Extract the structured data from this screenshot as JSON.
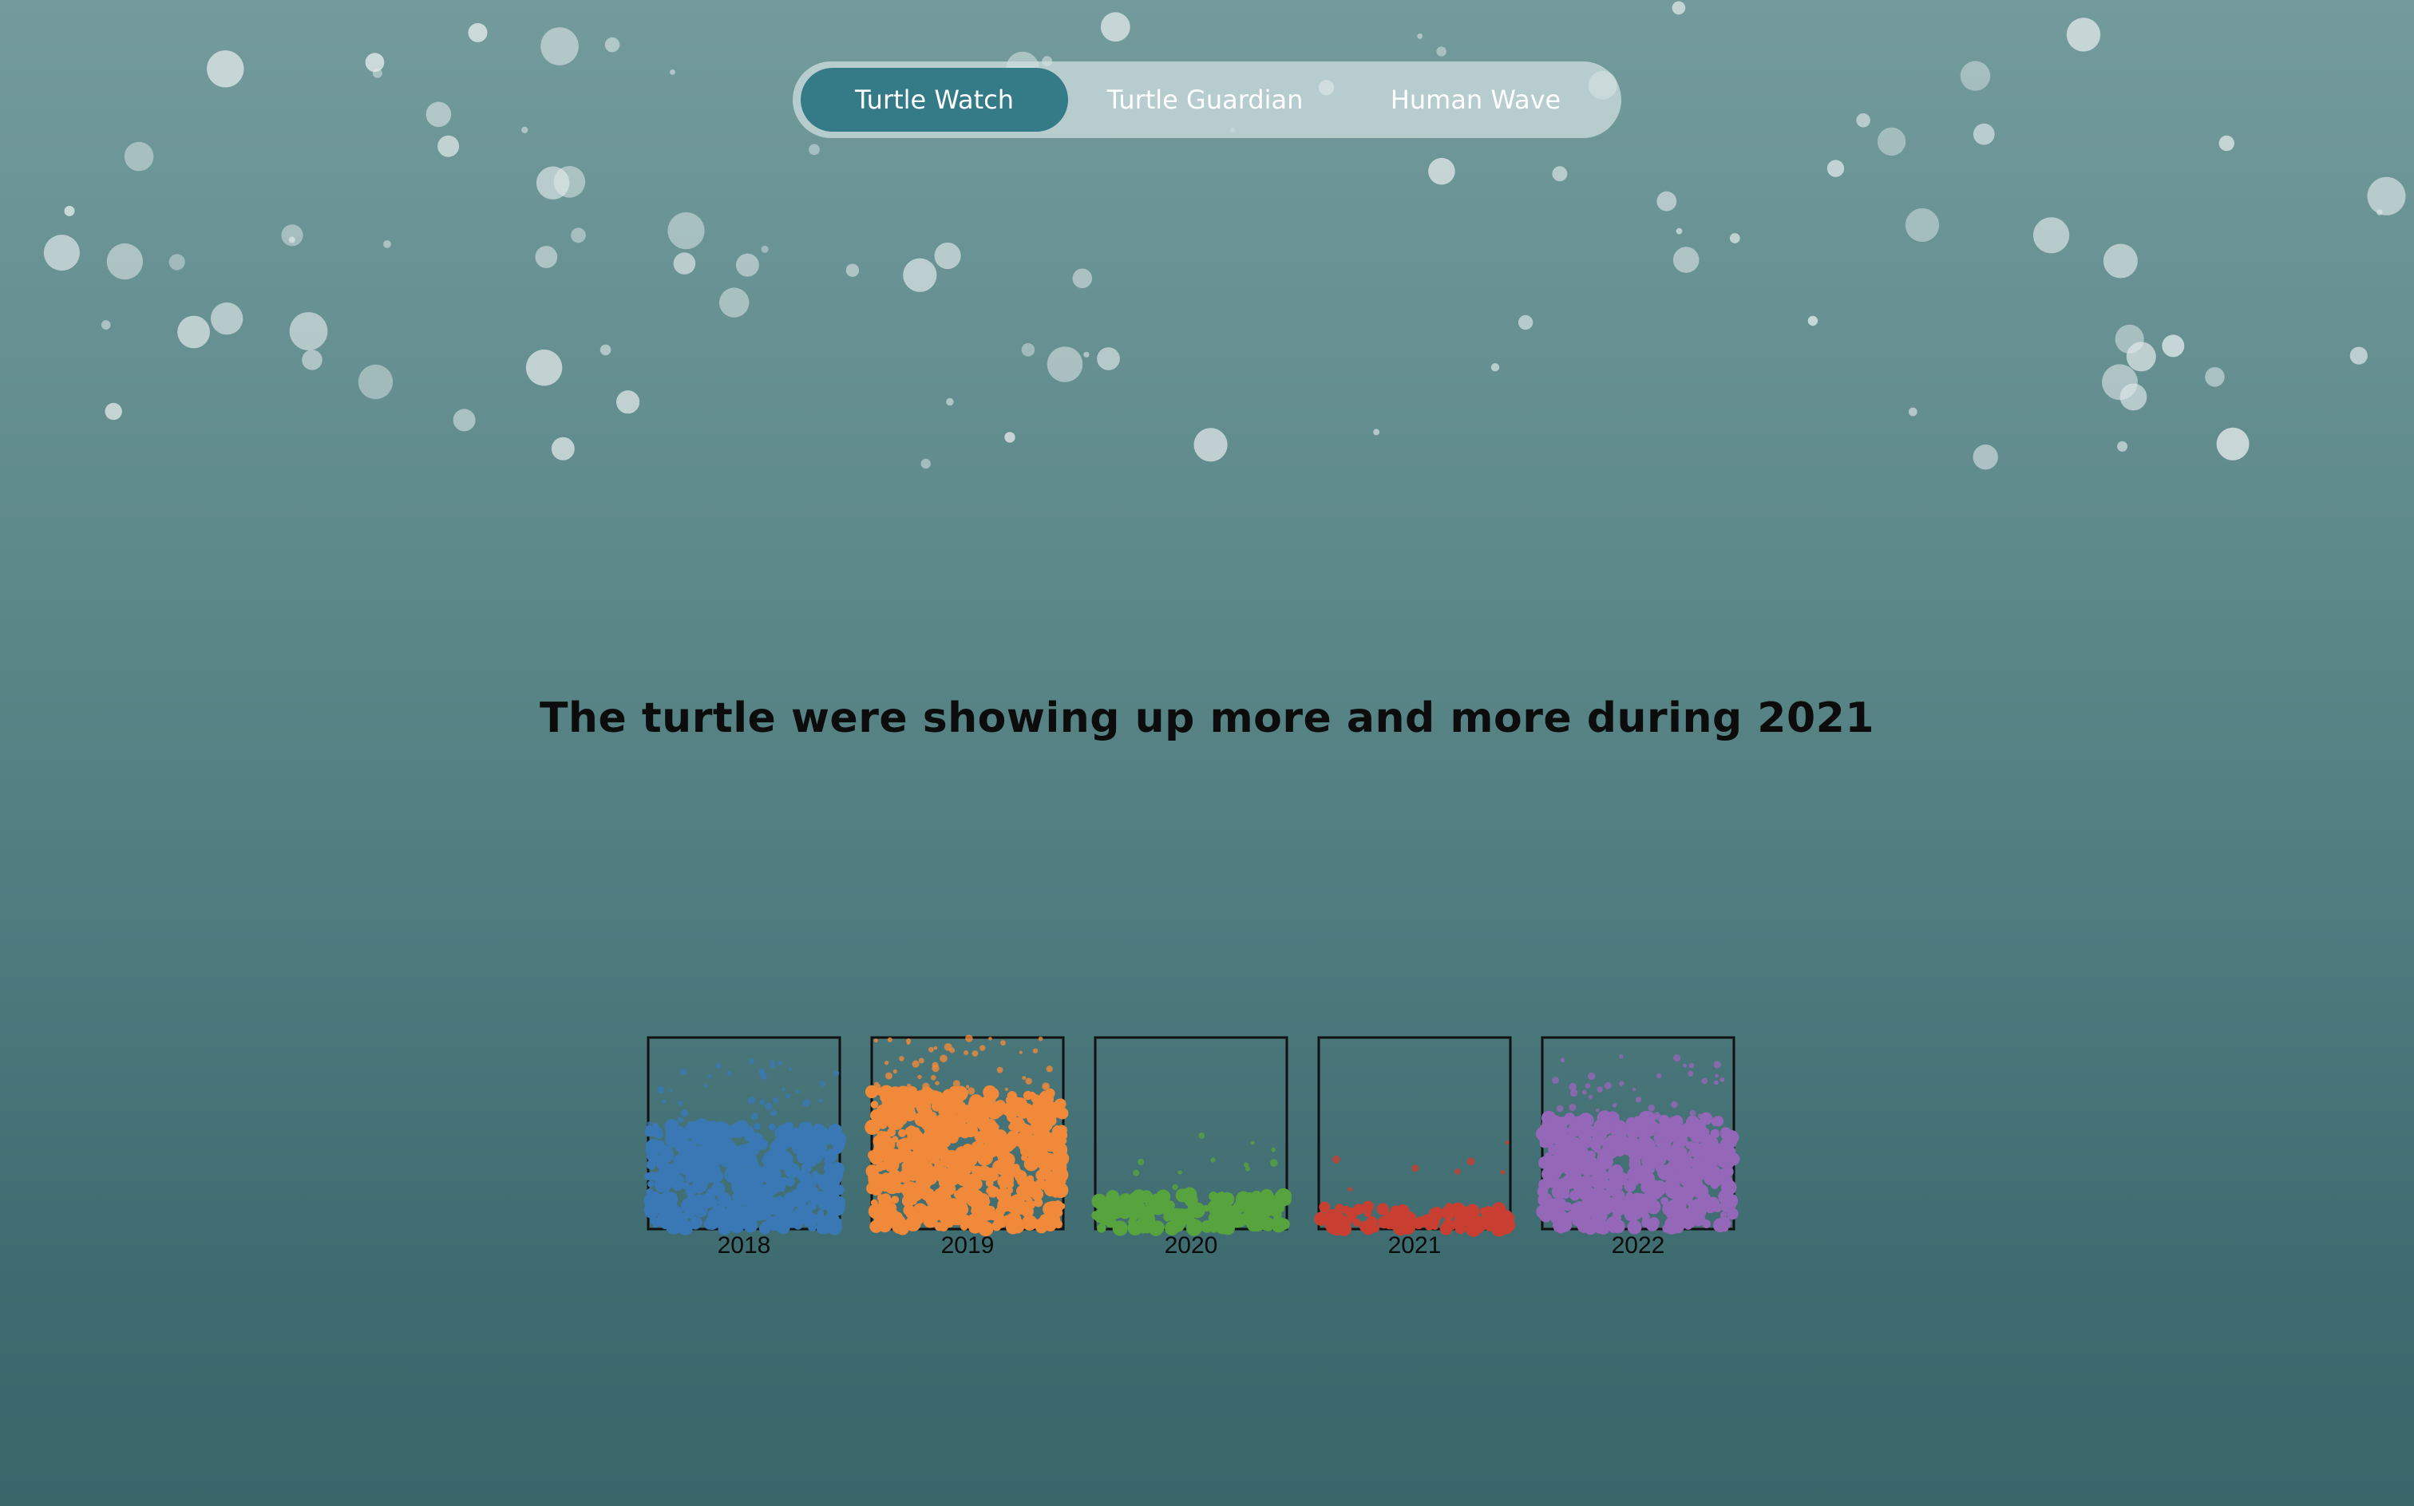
{
  "nav": {
    "tabs": [
      {
        "label": "Turtle Watch",
        "active": true
      },
      {
        "label": "Turtle Guardian",
        "active": false
      },
      {
        "label": "Human Wave",
        "active": false
      }
    ],
    "active_color": "#347a87"
  },
  "headline": "The turtle were showing up more and more during 2021",
  "chart_data": {
    "type": "scatter",
    "categories": [
      "2018",
      "2019",
      "2020",
      "2021",
      "2022"
    ],
    "fill_levels": [
      0.55,
      0.72,
      0.18,
      0.12,
      0.58
    ],
    "colors": [
      "#3a78b5",
      "#f0893a",
      "#57a33d",
      "#c83f31",
      "#9567b8"
    ],
    "title": "",
    "xlabel": "",
    "ylabel": ""
  }
}
